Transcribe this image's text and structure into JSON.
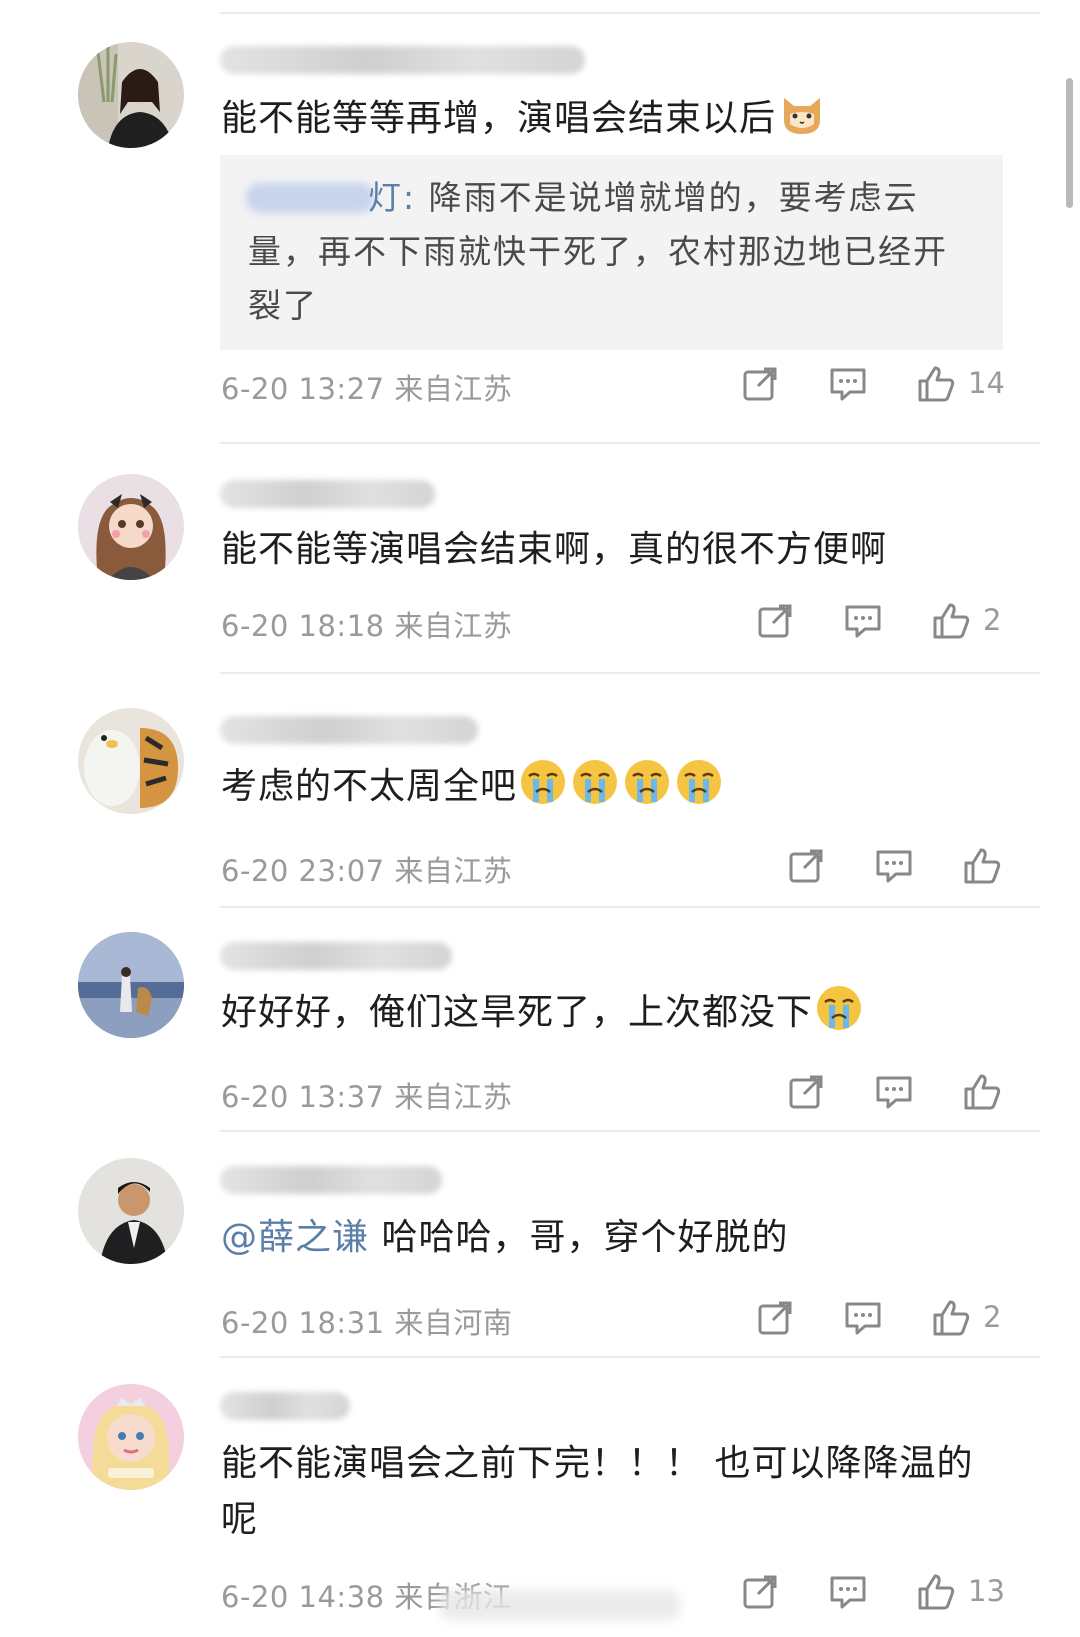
{
  "comments": [
    {
      "text": "能不能等等再增，演唱会结束以后",
      "emoji": "cat-face-emoji",
      "reply": {
        "name_tail": "灯:",
        "text": "降雨不是说增就增的，要考虑云量，再不下雨就快干死了，农村那边地已经开裂了"
      },
      "time": "6-20 13:27",
      "location": "来自江苏",
      "likes": "14"
    },
    {
      "text": "能不能等演唱会结束啊，真的很不方便啊",
      "time": "6-20 18:18",
      "location": "来自江苏",
      "likes": "2"
    },
    {
      "text": "考虑的不太周全吧",
      "emoji_count": 4,
      "emoji": "crying-face-emoji",
      "time": "6-20 23:07",
      "location": "来自江苏",
      "likes": ""
    },
    {
      "text": "好好好，俺们这旱死了，上次都没下",
      "emoji": "crying-face-emoji",
      "time": "6-20 13:37",
      "location": "来自江苏",
      "likes": ""
    },
    {
      "mention": "@薛之谦",
      "text": " 哈哈哈，哥，穿个好脱的",
      "time": "6-20 18:31",
      "location": "来自河南",
      "likes": "2"
    },
    {
      "text": "能不能演唱会之前下完！！！ 也可以降降温的呢",
      "time": "6-20 14:38",
      "location": "来自浙江",
      "likes": "13"
    }
  ],
  "colors": {
    "accent_link": "#5b7fa8",
    "meta_gray": "#9a9a9a",
    "quote_bg": "#f3f3f3"
  },
  "icons": [
    "share-icon",
    "comment-icon",
    "like-icon"
  ]
}
